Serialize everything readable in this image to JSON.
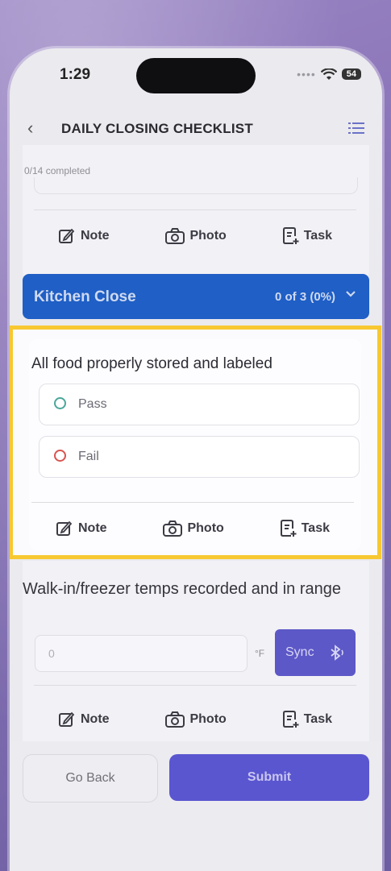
{
  "status_bar": {
    "time": "1:29",
    "battery": "54"
  },
  "header": {
    "title": "DAILY CLOSING CHECKLIST"
  },
  "progress_text": "0/14 completed",
  "actions": {
    "note": "Note",
    "photo": "Photo",
    "task": "Task"
  },
  "section": {
    "title": "Kitchen Close",
    "count": "0 of 3 (0%)"
  },
  "item1": {
    "question": "All food properly stored and labeled",
    "options": [
      {
        "label": "Pass",
        "color": "#4aa79a"
      },
      {
        "label": "Fail",
        "color": "#d9534f"
      }
    ]
  },
  "item2": {
    "question": "Walk-in/freezer temps recorded and in range",
    "input_value": "0",
    "unit": "°F",
    "sync_label": "Sync"
  },
  "footer": {
    "back_label": "Go Back",
    "submit_label": "Submit"
  },
  "colors": {
    "section_bg": "#1f5fc6",
    "primary": "#5a56d0",
    "highlight": "#f7c831"
  }
}
